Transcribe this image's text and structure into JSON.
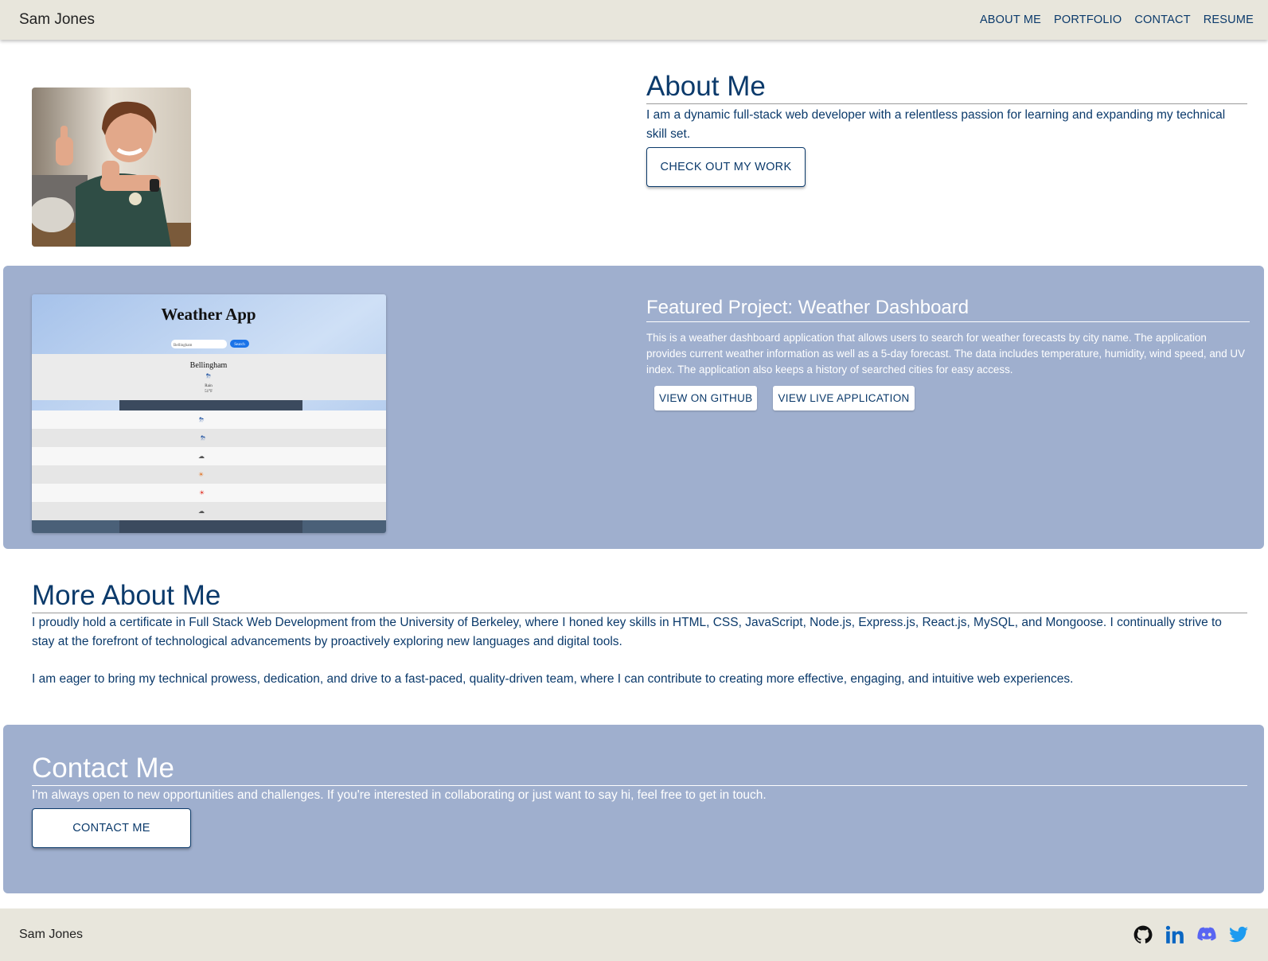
{
  "navbar": {
    "brand": "Sam Jones",
    "links": [
      "ABOUT ME",
      "PORTFOLIO",
      "CONTACT",
      "RESUME"
    ]
  },
  "about": {
    "title": "About Me",
    "description": "I am a dynamic full-stack web developer with a relentless passion for learning and expanding my technical skill set.",
    "button": "CHECK OUT MY WORK"
  },
  "featured": {
    "title": "Featured Project: Weather Dashboard",
    "description": "This is a weather dashboard application that allows users to search for weather forecasts by city name. The application provides current weather information as well as a 5-day forecast. The data includes temperature, humidity, wind speed, and UV index. The application also keeps a history of searched cities for easy access.",
    "github_button": "VIEW ON GITHUB",
    "live_button": "VIEW LIVE APPLICATION",
    "screenshot": {
      "app_title": "Weather App",
      "search_value": "Bellingham",
      "search_button": "Search",
      "city": "Bellingham",
      "condition": "Rain",
      "temp": "51°F"
    }
  },
  "more": {
    "title": "More About Me",
    "paragraph1": "I proudly hold a certificate in Full Stack Web Development from the University of Berkeley, where I honed key skills in HTML, CSS, JavaScript, Node.js, Express.js, React.js, MySQL, and Mongoose. I continually strive to stay at the forefront of technological advancements by proactively exploring new languages and digital tools.",
    "paragraph2": "I am eager to bring my technical prowess, dedication, and drive to a fast-paced, quality-driven team, where I can contribute to creating more effective, engaging, and intuitive web experiences."
  },
  "contact": {
    "title": "Contact Me",
    "description": "I'm always open to new opportunities and challenges. If you're interested in collaborating or just want to say hi, feel free to get in touch.",
    "button": "CONTACT ME"
  },
  "footer": {
    "name": "Sam Jones",
    "socials": [
      "github-icon",
      "linkedin-icon",
      "discord-icon",
      "twitter-icon"
    ]
  },
  "colors": {
    "primary_text": "#0b3a6b",
    "nav_bg": "#e8e6dc",
    "section_bg": "#9fafce",
    "linkedin": "#0a66c2",
    "discord": "#5865f2",
    "twitter": "#1d9bf0"
  }
}
